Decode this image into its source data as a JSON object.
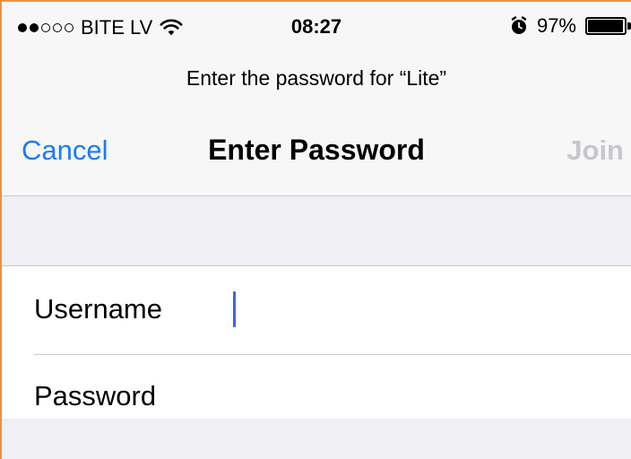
{
  "status_bar": {
    "carrier": "BITE LV",
    "signal_bars_filled": 2,
    "signal_bars_total": 5,
    "time": "08:27",
    "battery": "97%",
    "battery_level": 0.97,
    "icons": [
      "signal-dots-icon",
      "wifi-icon",
      "alarm-icon",
      "battery-icon"
    ]
  },
  "prompt": "Enter the password for “Lite”",
  "nav": {
    "cancel_label": "Cancel",
    "title": "Enter Password",
    "join_label": "Join"
  },
  "form": {
    "username_label": "Username",
    "username_value": "",
    "password_label": "Password",
    "password_value": ""
  },
  "colors": {
    "accent": "#1b7cf3",
    "disabled": "#c7c7cc",
    "caret": "#3b64e8",
    "frame_border": "#e8914a"
  }
}
